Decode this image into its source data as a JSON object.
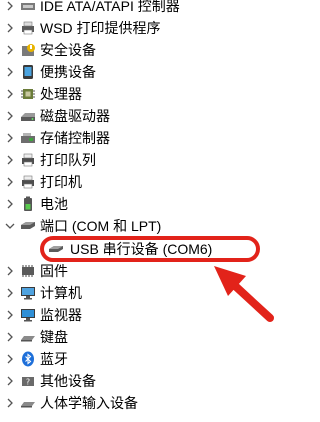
{
  "device_tree": {
    "items": [
      {
        "label": "IDE ATA/ATAPI 控制器",
        "icon": "ide-controller-icon",
        "state": "collapsed"
      },
      {
        "label": "WSD 打印提供程序",
        "icon": "printer-provider-icon",
        "state": "collapsed"
      },
      {
        "label": "安全设备",
        "icon": "security-device-icon",
        "state": "collapsed"
      },
      {
        "label": "便携设备",
        "icon": "portable-device-icon",
        "state": "collapsed"
      },
      {
        "label": "处理器",
        "icon": "processor-icon",
        "state": "collapsed"
      },
      {
        "label": "磁盘驱动器",
        "icon": "disk-drive-icon",
        "state": "collapsed"
      },
      {
        "label": "存储控制器",
        "icon": "storage-controller-icon",
        "state": "collapsed"
      },
      {
        "label": "打印队列",
        "icon": "print-queue-icon",
        "state": "collapsed"
      },
      {
        "label": "打印机",
        "icon": "printer-icon",
        "state": "collapsed"
      },
      {
        "label": "电池",
        "icon": "battery-icon",
        "state": "collapsed"
      },
      {
        "label": "端口 (COM 和 LPT)",
        "icon": "port-icon",
        "state": "expanded"
      },
      {
        "label": "USB 串行设备 (COM6)",
        "icon": "usb-serial-icon",
        "state": "child"
      },
      {
        "label": "固件",
        "icon": "firmware-icon",
        "state": "collapsed"
      },
      {
        "label": "计算机",
        "icon": "computer-icon",
        "state": "collapsed"
      },
      {
        "label": "监视器",
        "icon": "monitor-icon",
        "state": "collapsed"
      },
      {
        "label": "键盘",
        "icon": "keyboard-icon",
        "state": "collapsed"
      },
      {
        "label": "蓝牙",
        "icon": "bluetooth-icon",
        "state": "collapsed"
      },
      {
        "label": "其他设备",
        "icon": "other-device-icon",
        "state": "collapsed"
      },
      {
        "label": "人体学输入设备",
        "icon": "hid-icon",
        "state": "collapsed"
      }
    ]
  },
  "annotation": {
    "highlight_color": "#e2231a",
    "target": "USB 串行设备 (COM6)"
  }
}
